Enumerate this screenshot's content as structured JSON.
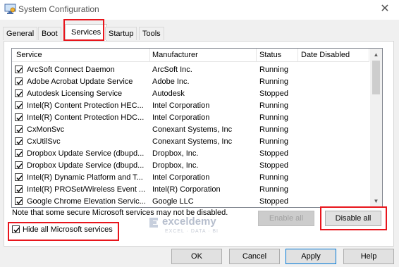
{
  "window": {
    "title": "System Configuration",
    "close_glyph": "✕"
  },
  "tabs": [
    {
      "label": "General"
    },
    {
      "label": "Boot"
    },
    {
      "label": "Services"
    },
    {
      "label": "Startup"
    },
    {
      "label": "Tools"
    }
  ],
  "active_tab": "Services",
  "table": {
    "columns": [
      "Service",
      "Manufacturer",
      "Status",
      "Date Disabled"
    ],
    "rows": [
      {
        "checked": true,
        "service": "ArcSoft Connect Daemon",
        "manufacturer": "ArcSoft Inc.",
        "status": "Running",
        "date_disabled": ""
      },
      {
        "checked": true,
        "service": "Adobe Acrobat Update Service",
        "manufacturer": "Adobe Inc.",
        "status": "Running",
        "date_disabled": ""
      },
      {
        "checked": true,
        "service": "Autodesk Licensing Service",
        "manufacturer": "Autodesk",
        "status": "Stopped",
        "date_disabled": ""
      },
      {
        "checked": true,
        "service": "Intel(R) Content Protection HEC...",
        "manufacturer": "Intel Corporation",
        "status": "Running",
        "date_disabled": ""
      },
      {
        "checked": true,
        "service": "Intel(R) Content Protection HDC...",
        "manufacturer": "Intel Corporation",
        "status": "Running",
        "date_disabled": ""
      },
      {
        "checked": true,
        "service": "CxMonSvc",
        "manufacturer": "Conexant Systems, Inc",
        "status": "Running",
        "date_disabled": ""
      },
      {
        "checked": true,
        "service": "CxUtilSvc",
        "manufacturer": "Conexant Systems, Inc",
        "status": "Running",
        "date_disabled": ""
      },
      {
        "checked": true,
        "service": "Dropbox Update Service (dbupd...",
        "manufacturer": "Dropbox, Inc.",
        "status": "Stopped",
        "date_disabled": ""
      },
      {
        "checked": true,
        "service": "Dropbox Update Service (dbupd...",
        "manufacturer": "Dropbox, Inc.",
        "status": "Stopped",
        "date_disabled": ""
      },
      {
        "checked": true,
        "service": "Intel(R) Dynamic Platform and T...",
        "manufacturer": "Intel Corporation",
        "status": "Running",
        "date_disabled": ""
      },
      {
        "checked": true,
        "service": "Intel(R) PROSet/Wireless Event ...",
        "manufacturer": "Intel(R) Corporation",
        "status": "Running",
        "date_disabled": ""
      },
      {
        "checked": true,
        "service": "Google Chrome Elevation Servic...",
        "manufacturer": "Google LLC",
        "status": "Stopped",
        "date_disabled": ""
      }
    ]
  },
  "note": "Note that some secure Microsoft services may not be disabled.",
  "buttons": {
    "enable_all": "Enable all",
    "disable_all": "Disable all",
    "ok": "OK",
    "cancel": "Cancel",
    "apply": "Apply",
    "help": "Help"
  },
  "hide_ms": {
    "checked": true,
    "label": "Hide all Microsoft services"
  },
  "watermark": {
    "name": "exceldemy",
    "tagline": "EXCEL · DATA · BI"
  },
  "colors": {
    "highlight": "#e8151c",
    "accent": "#0078d7"
  }
}
